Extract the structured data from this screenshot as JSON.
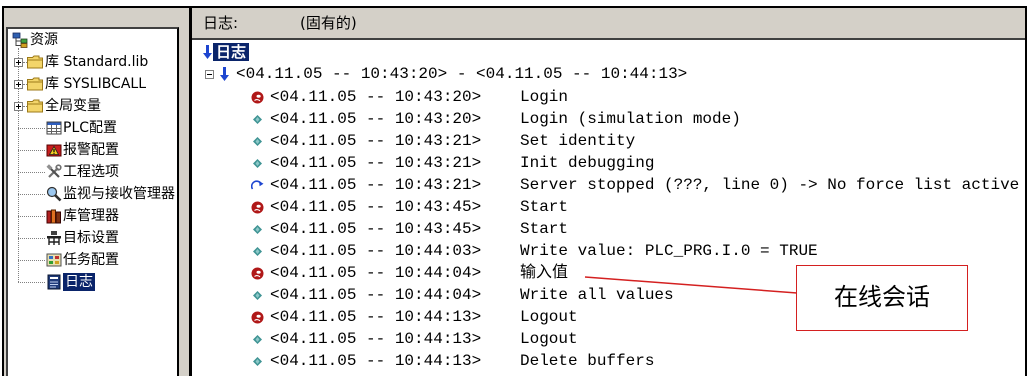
{
  "colors": {
    "selection": "#0a246a",
    "panel_gray": "#d4d0c8",
    "annotation": "#d42020",
    "event_diamond": "#3f9494",
    "user_action": "#b01818",
    "arrow_blue": "#1e46d0"
  },
  "resources": {
    "root": {
      "label": "资源",
      "icon": "resources-icon"
    },
    "items": [
      {
        "label": "库 Standard.lib",
        "icon": "folder-icon",
        "expandable": true
      },
      {
        "label": "库 SYSLIBCALL",
        "icon": "folder-icon",
        "expandable": true
      },
      {
        "label": "全局变量",
        "icon": "folder-icon",
        "expandable": true
      },
      {
        "label": "PLC配置",
        "icon": "plc-config-icon"
      },
      {
        "label": "报警配置",
        "icon": "alarm-config-icon"
      },
      {
        "label": "工程选项",
        "icon": "tools-icon"
      },
      {
        "label": "监视与接收管理器",
        "icon": "watch-manager-icon"
      },
      {
        "label": "库管理器",
        "icon": "library-manager-icon"
      },
      {
        "label": "目标设置",
        "icon": "target-settings-icon"
      },
      {
        "label": "任务配置",
        "icon": "task-config-icon"
      },
      {
        "label": "日志",
        "icon": "log-icon",
        "selected": true
      }
    ]
  },
  "log": {
    "header": {
      "title": "日志:",
      "mode": "(固有的)"
    },
    "root": {
      "label": "日志",
      "icon": "arrow-down-icon"
    },
    "session": {
      "range": "<04.11.05 -- 10:43:20> - <04.11.05 -- 10:44:13>",
      "expander": "collapse-icon",
      "icon": "arrow-down-icon"
    },
    "entries": [
      {
        "icon": "user-action-icon",
        "time": "<04.11.05 -- 10:43:20>",
        "message": "Login"
      },
      {
        "icon": "event-diamond-icon",
        "time": "<04.11.05 -- 10:43:20>",
        "message": "Login (simulation mode)"
      },
      {
        "icon": "event-diamond-icon",
        "time": "<04.11.05 -- 10:43:21>",
        "message": "Set identity"
      },
      {
        "icon": "event-diamond-icon",
        "time": "<04.11.05 -- 10:43:21>",
        "message": "Init debugging"
      },
      {
        "icon": "server-arrow-icon",
        "time": "<04.11.05 -- 10:43:21>",
        "message": "Server stopped (???, line 0) -> No force list active"
      },
      {
        "icon": "user-action-icon",
        "time": "<04.11.05 -- 10:43:45>",
        "message": "Start"
      },
      {
        "icon": "event-diamond-icon",
        "time": "<04.11.05 -- 10:43:45>",
        "message": "Start"
      },
      {
        "icon": "event-diamond-icon",
        "time": "<04.11.05 -- 10:44:03>",
        "message": "Write value: PLC_PRG.I.0 = TRUE"
      },
      {
        "icon": "user-action-icon",
        "time": "<04.11.05 -- 10:44:04>",
        "message": "输入值"
      },
      {
        "icon": "event-diamond-icon",
        "time": "<04.11.05 -- 10:44:04>",
        "message": "Write all values"
      },
      {
        "icon": "user-action-icon",
        "time": "<04.11.05 -- 10:44:13>",
        "message": "Logout"
      },
      {
        "icon": "event-diamond-icon",
        "time": "<04.11.05 -- 10:44:13>",
        "message": "Logout"
      },
      {
        "icon": "event-diamond-icon",
        "time": "<04.11.05 -- 10:44:13>",
        "message": "Delete buffers"
      }
    ]
  },
  "annotation": {
    "label": "在线会话"
  }
}
